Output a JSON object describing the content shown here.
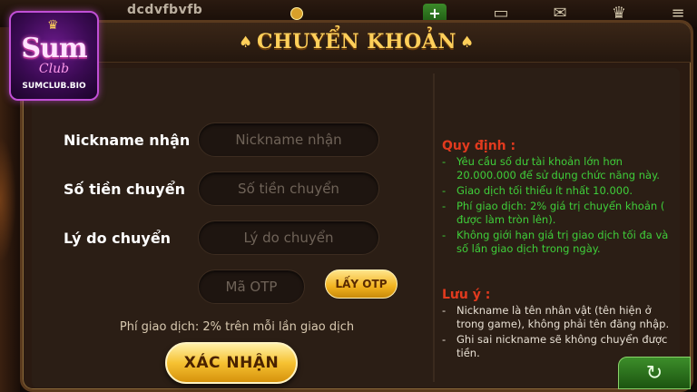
{
  "topbar": {
    "username": "dcdvfbvfb",
    "plus_label": "+",
    "icons": [
      "coin-icon",
      "wallet-icon",
      "mail-icon",
      "crown-icon",
      "menu-icon"
    ]
  },
  "logo": {
    "title": "Sum",
    "subtitle": "Club",
    "domain": "SUMCLUB.BIO"
  },
  "panel": {
    "title": "CHUYỂN KHOẢN",
    "spade": "♠"
  },
  "form": {
    "nickname_label": "Nickname nhận",
    "nickname_placeholder": "Nickname nhận",
    "amount_label": "Số tiền chuyển",
    "amount_placeholder": "Số tiền chuyển",
    "reason_label": "Lý do chuyển",
    "reason_placeholder": "Lý do chuyển",
    "otp_placeholder": "Mã OTP",
    "otp_button": "LẤY OTP",
    "fee_text": "Phí giao dịch: 2% trên mỗi lần giao dịch",
    "confirm_button": "XÁC NHẬN"
  },
  "rules": {
    "heading": "Quy định :",
    "items": [
      "Yêu cầu số dư tài khoản lớn hơn 20.000.000 để sử dụng chức năng này.",
      "Giao dịch tối thiểu ít nhất 10.000.",
      "Phí giao dịch: 2% giá trị chuyển khoản ( được làm tròn lên).",
      "Không giới hạn giá trị giao dịch tối đa và số lần giao dịch trong ngày."
    ]
  },
  "notes": {
    "heading": "Lưu ý :",
    "items": [
      "Nickname là tên nhân vật (tên hiện ở trong game), không phải tên đăng nhập.",
      "Ghi sai nickname sẽ không chuyển được tiền."
    ]
  },
  "colors": {
    "gold_accent": "#ffcf5a",
    "rules_green": "#3fce3a",
    "heading_red": "#e23a1e"
  }
}
